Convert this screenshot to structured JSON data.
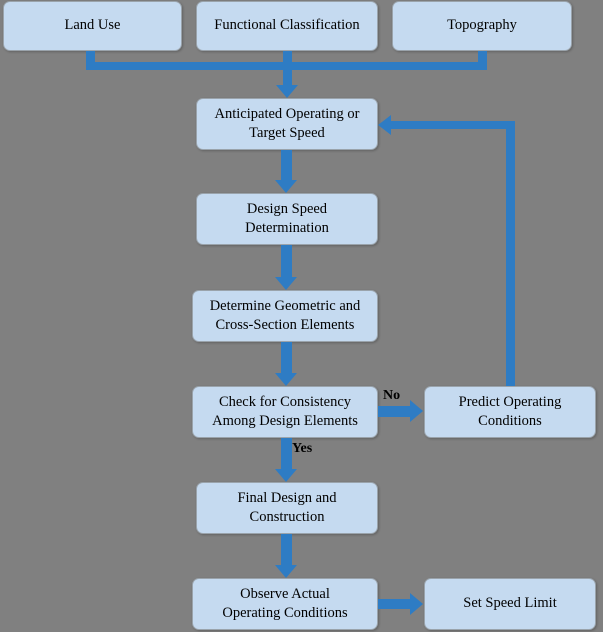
{
  "diagram": {
    "title": "Speed Based Design Process Flowchart",
    "background_color": "#808080",
    "node_fill_color": "#c5daf0",
    "node_border_color": "#9aa3ab",
    "arrow_color": "#2e7cc4",
    "text_color": "#000000"
  },
  "nodes": {
    "land_use": "Land Use",
    "functional_classification": "Functional Classification",
    "topography": "Topography",
    "anticipated_speed": "Anticipated Operating or\nTarget Speed",
    "design_speed": "Design Speed\nDetermination",
    "geometric_elements": "Determine Geometric and\nCross-Section Elements",
    "check_consistency": "Check for Consistency\nAmong Design Elements",
    "predict_operating": "Predict Operating\nConditions",
    "final_design": "Final Design and\nConstruction",
    "observe_actual": "Observe Actual\nOperating Conditions",
    "set_speed_limit": "Set Speed Limit"
  },
  "edge_labels": {
    "no": "No",
    "yes": "Yes"
  }
}
